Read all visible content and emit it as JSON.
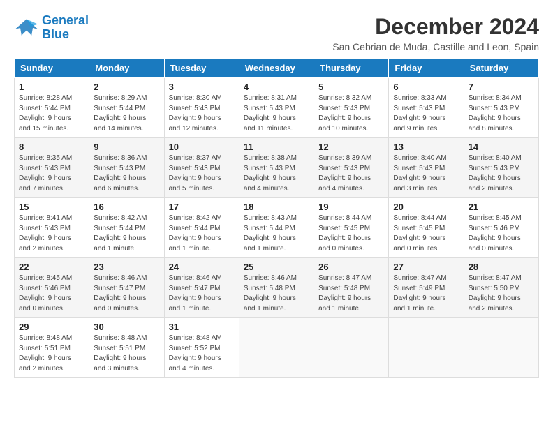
{
  "logo": {
    "line1": "General",
    "line2": "Blue"
  },
  "title": "December 2024",
  "subtitle": "San Cebrian de Muda, Castille and Leon, Spain",
  "days_header": [
    "Sunday",
    "Monday",
    "Tuesday",
    "Wednesday",
    "Thursday",
    "Friday",
    "Saturday"
  ],
  "weeks": [
    [
      {
        "day": "1",
        "sunrise": "8:28 AM",
        "sunset": "5:44 PM",
        "daylight": "9 hours and 15 minutes."
      },
      {
        "day": "2",
        "sunrise": "8:29 AM",
        "sunset": "5:44 PM",
        "daylight": "9 hours and 14 minutes."
      },
      {
        "day": "3",
        "sunrise": "8:30 AM",
        "sunset": "5:43 PM",
        "daylight": "9 hours and 12 minutes."
      },
      {
        "day": "4",
        "sunrise": "8:31 AM",
        "sunset": "5:43 PM",
        "daylight": "9 hours and 11 minutes."
      },
      {
        "day": "5",
        "sunrise": "8:32 AM",
        "sunset": "5:43 PM",
        "daylight": "9 hours and 10 minutes."
      },
      {
        "day": "6",
        "sunrise": "8:33 AM",
        "sunset": "5:43 PM",
        "daylight": "9 hours and 9 minutes."
      },
      {
        "day": "7",
        "sunrise": "8:34 AM",
        "sunset": "5:43 PM",
        "daylight": "9 hours and 8 minutes."
      }
    ],
    [
      {
        "day": "8",
        "sunrise": "8:35 AM",
        "sunset": "5:43 PM",
        "daylight": "9 hours and 7 minutes."
      },
      {
        "day": "9",
        "sunrise": "8:36 AM",
        "sunset": "5:43 PM",
        "daylight": "9 hours and 6 minutes."
      },
      {
        "day": "10",
        "sunrise": "8:37 AM",
        "sunset": "5:43 PM",
        "daylight": "9 hours and 5 minutes."
      },
      {
        "day": "11",
        "sunrise": "8:38 AM",
        "sunset": "5:43 PM",
        "daylight": "9 hours and 4 minutes."
      },
      {
        "day": "12",
        "sunrise": "8:39 AM",
        "sunset": "5:43 PM",
        "daylight": "9 hours and 4 minutes."
      },
      {
        "day": "13",
        "sunrise": "8:40 AM",
        "sunset": "5:43 PM",
        "daylight": "9 hours and 3 minutes."
      },
      {
        "day": "14",
        "sunrise": "8:40 AM",
        "sunset": "5:43 PM",
        "daylight": "9 hours and 2 minutes."
      }
    ],
    [
      {
        "day": "15",
        "sunrise": "8:41 AM",
        "sunset": "5:43 PM",
        "daylight": "9 hours and 2 minutes."
      },
      {
        "day": "16",
        "sunrise": "8:42 AM",
        "sunset": "5:44 PM",
        "daylight": "9 hours and 1 minute."
      },
      {
        "day": "17",
        "sunrise": "8:42 AM",
        "sunset": "5:44 PM",
        "daylight": "9 hours and 1 minute."
      },
      {
        "day": "18",
        "sunrise": "8:43 AM",
        "sunset": "5:44 PM",
        "daylight": "9 hours and 1 minute."
      },
      {
        "day": "19",
        "sunrise": "8:44 AM",
        "sunset": "5:45 PM",
        "daylight": "9 hours and 0 minutes."
      },
      {
        "day": "20",
        "sunrise": "8:44 AM",
        "sunset": "5:45 PM",
        "daylight": "9 hours and 0 minutes."
      },
      {
        "day": "21",
        "sunrise": "8:45 AM",
        "sunset": "5:46 PM",
        "daylight": "9 hours and 0 minutes."
      }
    ],
    [
      {
        "day": "22",
        "sunrise": "8:45 AM",
        "sunset": "5:46 PM",
        "daylight": "9 hours and 0 minutes."
      },
      {
        "day": "23",
        "sunrise": "8:46 AM",
        "sunset": "5:47 PM",
        "daylight": "9 hours and 0 minutes."
      },
      {
        "day": "24",
        "sunrise": "8:46 AM",
        "sunset": "5:47 PM",
        "daylight": "9 hours and 1 minute."
      },
      {
        "day": "25",
        "sunrise": "8:46 AM",
        "sunset": "5:48 PM",
        "daylight": "9 hours and 1 minute."
      },
      {
        "day": "26",
        "sunrise": "8:47 AM",
        "sunset": "5:48 PM",
        "daylight": "9 hours and 1 minute."
      },
      {
        "day": "27",
        "sunrise": "8:47 AM",
        "sunset": "5:49 PM",
        "daylight": "9 hours and 1 minute."
      },
      {
        "day": "28",
        "sunrise": "8:47 AM",
        "sunset": "5:50 PM",
        "daylight": "9 hours and 2 minutes."
      }
    ],
    [
      {
        "day": "29",
        "sunrise": "8:48 AM",
        "sunset": "5:51 PM",
        "daylight": "9 hours and 2 minutes."
      },
      {
        "day": "30",
        "sunrise": "8:48 AM",
        "sunset": "5:51 PM",
        "daylight": "9 hours and 3 minutes."
      },
      {
        "day": "31",
        "sunrise": "8:48 AM",
        "sunset": "5:52 PM",
        "daylight": "9 hours and 4 minutes."
      },
      null,
      null,
      null,
      null
    ]
  ]
}
